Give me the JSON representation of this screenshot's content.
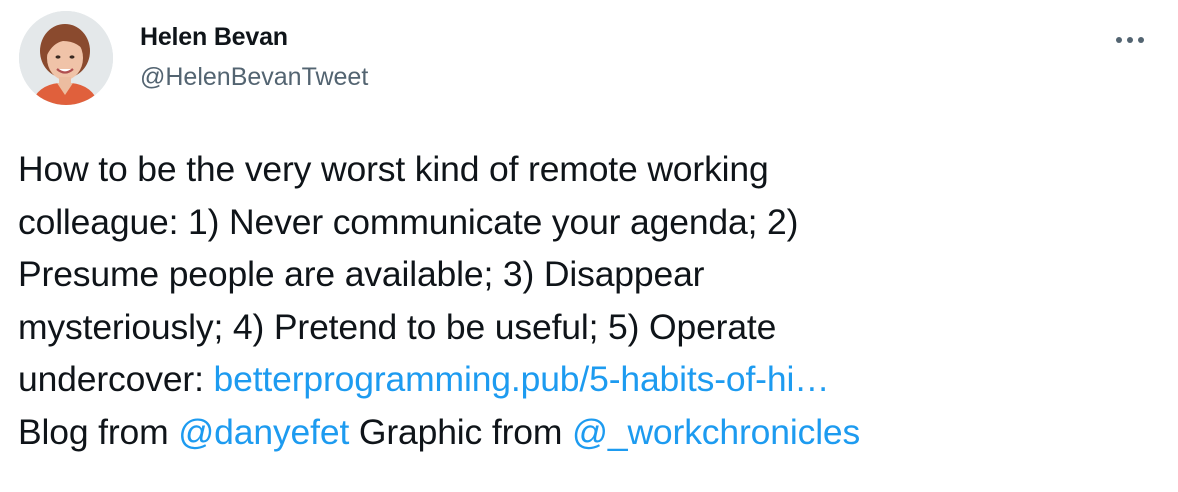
{
  "author": {
    "display_name": "Helen Bevan",
    "handle": "@HelenBevanTweet",
    "avatar_icon": "user-avatar-photo"
  },
  "more_icon": "more-dots-icon",
  "tweet": {
    "line1": "How to be the very worst kind of remote working",
    "line2": "colleague: 1) Never communicate your agenda; 2)",
    "line3": "Presume people are available; 3) Disappear",
    "line4": "mysteriously; 4) Pretend to be useful; 5) Operate",
    "line5_prefix": "undercover: ",
    "link_url": "betterprogramming.pub/5-habits-of-hi…",
    "line6_prefix": "Blog from ",
    "mention_1": "@danyefet",
    "line6_middle": " Graphic from ",
    "mention_2": "@_workchronicles"
  },
  "colors": {
    "link": "#1d9bf0",
    "text": "#0f1419",
    "secondary": "#536471"
  }
}
